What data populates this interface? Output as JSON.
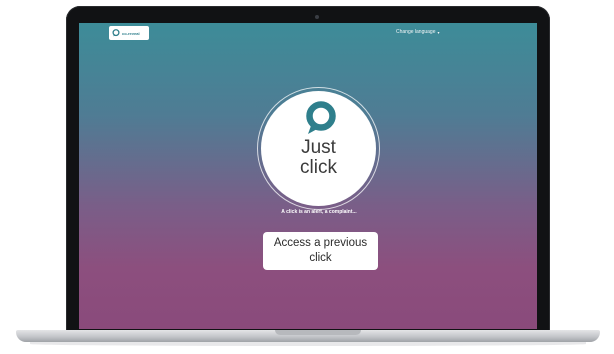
{
  "header": {
    "logo_text": "co-reveal",
    "language_label": "Change language",
    "language_caret_icon": "caret-down-icon"
  },
  "hero": {
    "logo_icon": "speech-bubble-icon",
    "title_line1": "Just",
    "title_line2": "click",
    "tagline": "A click is an alert, a complaint...",
    "access_button_label": "Access a previous click"
  },
  "colors": {
    "teal": "#3d8c98",
    "plum": "#8a4a7b",
    "logo_teal": "#2f7f8c",
    "text_dark": "#3b3b3b"
  }
}
